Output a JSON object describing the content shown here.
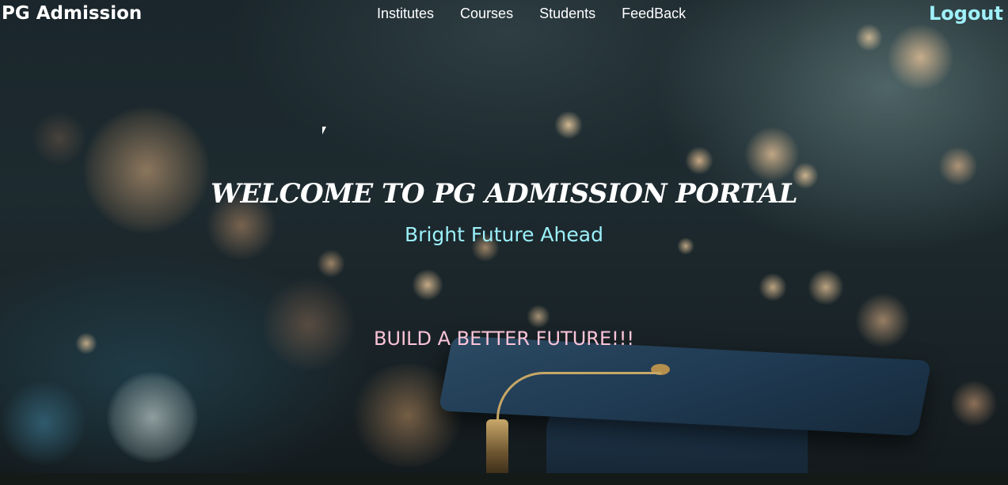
{
  "navbar": {
    "brand": "PG Admission",
    "links": [
      "Institutes",
      "Courses",
      "Students",
      "FeedBack"
    ],
    "logout": "Logout"
  },
  "hero": {
    "title": "WELCOME TO PG ADMISSION PORTAL",
    "subtitle": "Bright Future Ahead",
    "tagline": "BUILD A BETTER FUTURE!!!"
  },
  "colors": {
    "logout": "#9ff0fb",
    "subtitle": "#9beff9",
    "tagline": "#fbc4d8",
    "text": "#ffffff"
  }
}
